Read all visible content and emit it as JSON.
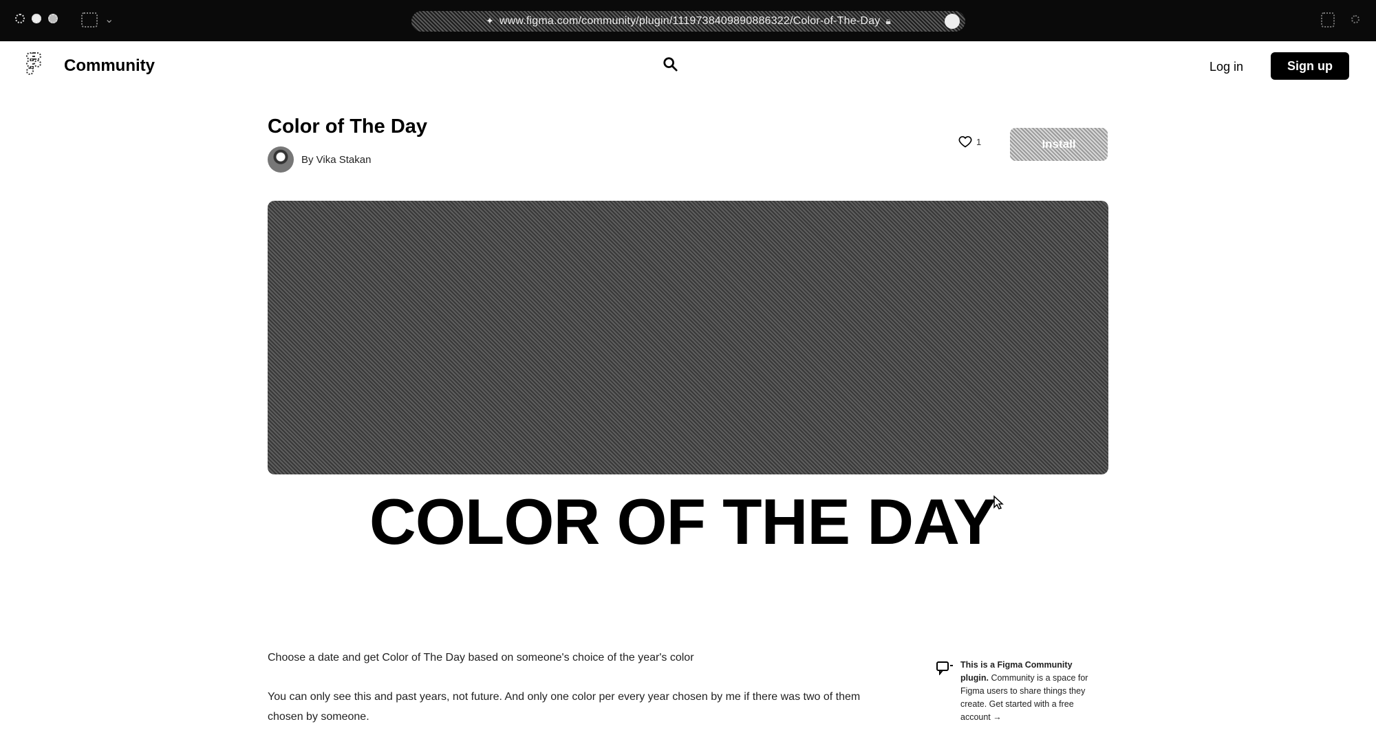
{
  "browser": {
    "url": "www.figma.com/community/plugin/1119738409890886322/Color-of-The-Day",
    "icons": [
      "close-dot",
      "minimize-dot",
      "maximize-dot",
      "sidebar-icon",
      "chevron-down-icon",
      "page-icon",
      "lock-icon",
      "extension-icon",
      "share-icon",
      "download-icon"
    ]
  },
  "header": {
    "community_label": "Community",
    "login_label": "Log in",
    "signup_label": "Sign up"
  },
  "plugin": {
    "title": "Color of The Day",
    "author_line": "By Vika Stakan",
    "like_count": "1",
    "install_label": "Install",
    "cover_heading": "COLOR OF THE DAY",
    "description": [
      "Choose a date and get Color of The Day based on someone's choice of the year's color",
      "You can only see this and past years, not future. And only one color per every year chosen by me if there was two of them chosen by someone."
    ]
  },
  "info_panel": {
    "bold": "This is a Figma Community plugin.",
    "rest": " Community is a space for Figma users to share things they create. Get started with a free account →"
  },
  "colors": {
    "browser_bar": "#0a0a0a",
    "accent": "#000000",
    "background": "#ffffff"
  }
}
